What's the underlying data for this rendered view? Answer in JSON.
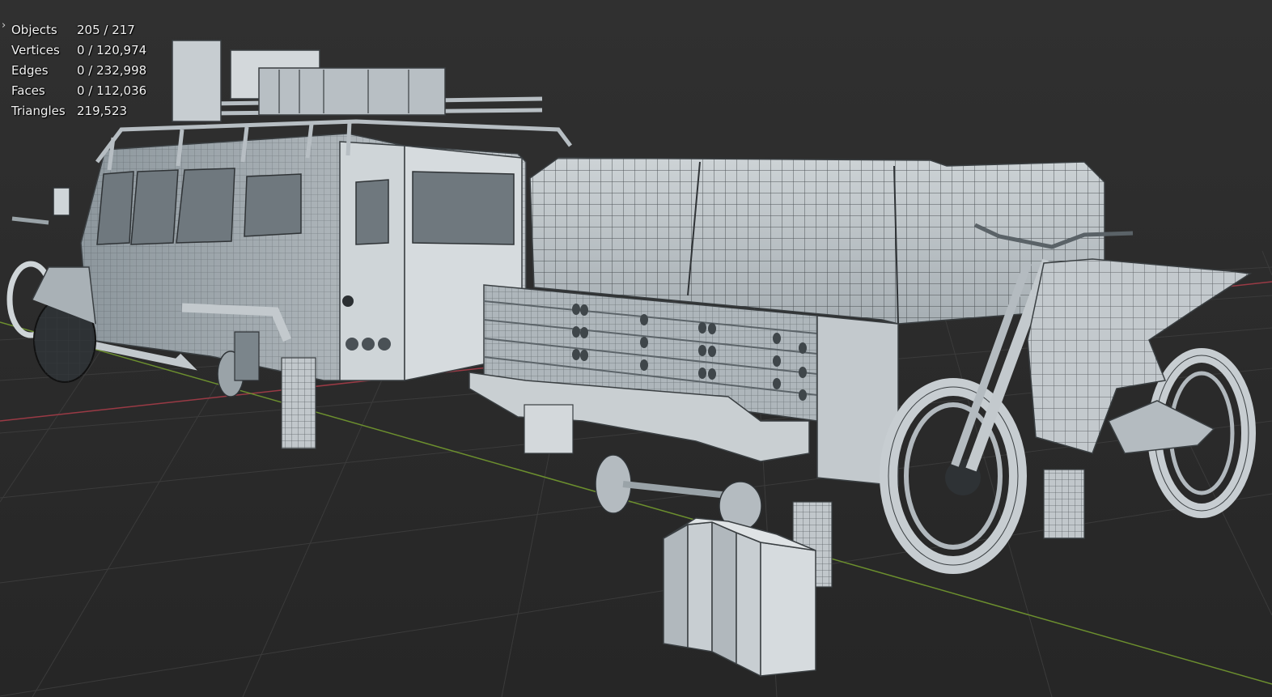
{
  "viewport": {
    "background": "#2b2b2b",
    "grid_color": "#3d3d3d",
    "axis_x_color": "#9a3a45",
    "axis_y_color": "#6c8f2e",
    "model_light": "#d8dde0",
    "model_mid": "#b9c0c5",
    "model_dark": "#8c969c",
    "wire_color": "#3a3f42"
  },
  "stats_toggle_icon": "chevron-right-icon",
  "stats": [
    {
      "label": "Objects",
      "value": "205 / 217"
    },
    {
      "label": "Vertices",
      "value": "0 / 120,974"
    },
    {
      "label": "Edges",
      "value": "0 / 232,998"
    },
    {
      "label": "Faces",
      "value": "0 / 112,036"
    },
    {
      "label": "Triangles",
      "value": "219,523"
    }
  ]
}
